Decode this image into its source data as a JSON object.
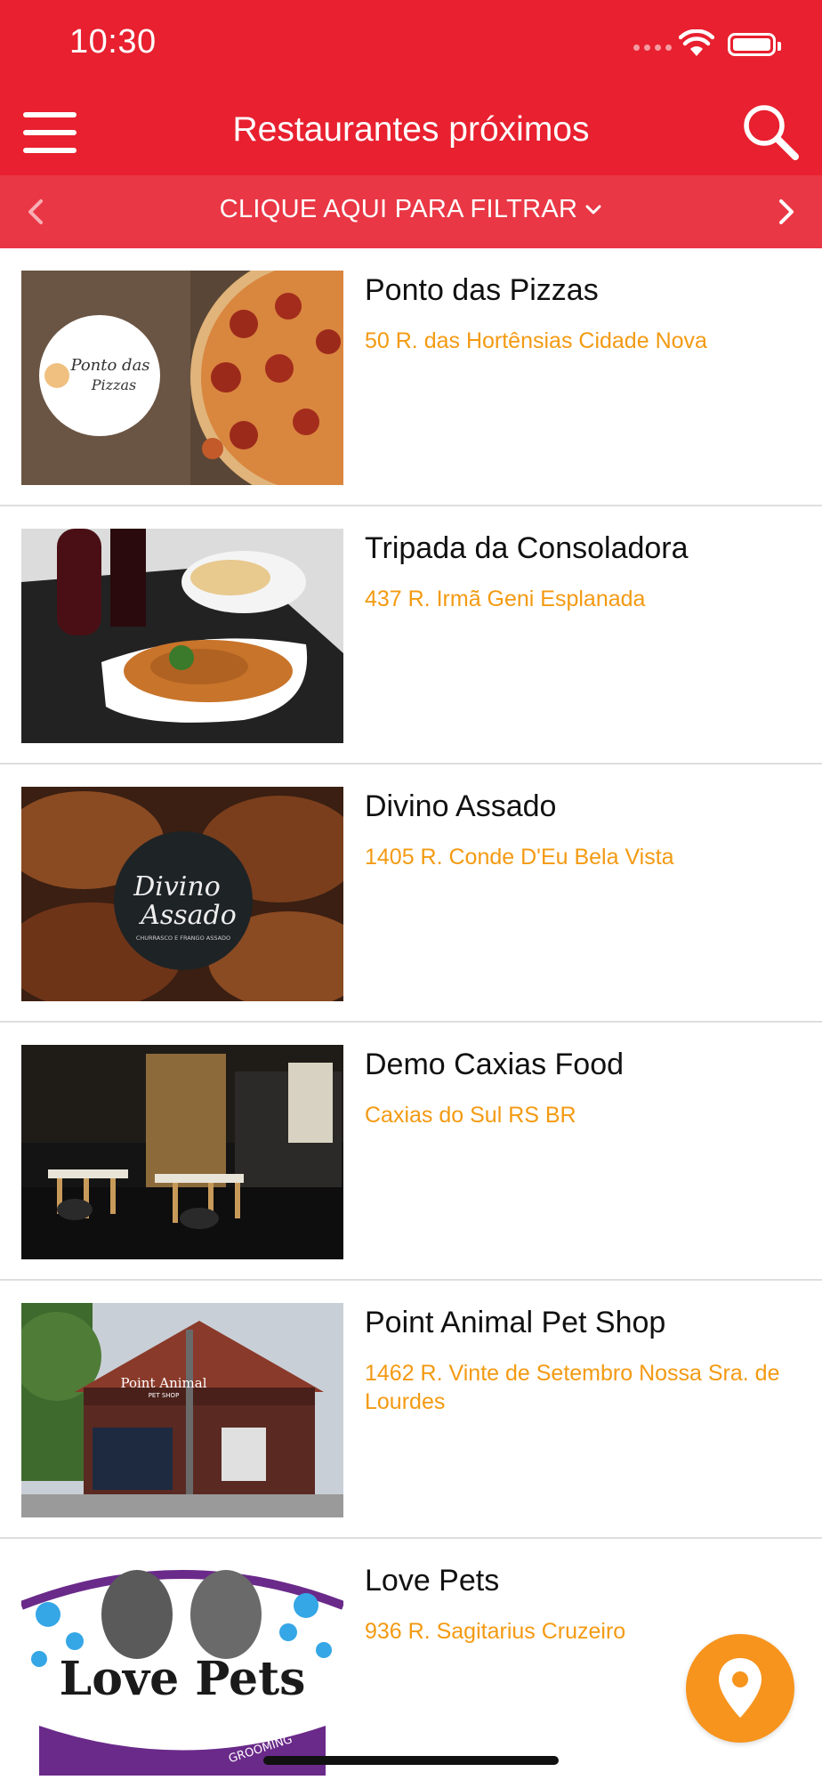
{
  "status_bar": {
    "time": "10:30"
  },
  "header": {
    "title": "Restaurantes próximos",
    "menu_icon": "hamburger-menu-icon",
    "search_icon": "search-icon"
  },
  "filter": {
    "label": "CLIQUE AQUI PARA FILTRAR"
  },
  "restaurants": [
    {
      "name": "Ponto das Pizzas",
      "address": "50 R. das Hortênsias Cidade Nova",
      "logo_text": [
        "Ponto das",
        "Pizzas"
      ]
    },
    {
      "name": "Tripada da Consoladora",
      "address": "437 R. Irmã Geni Esplanada"
    },
    {
      "name": "Divino Assado",
      "address": "1405 R. Conde D'Eu Bela Vista",
      "logo_text": [
        "Divino",
        "Assado",
        "CHURRASCO E FRANGO ASSADO"
      ]
    },
    {
      "name": "Demo Caxias Food",
      "address": "Caxias do Sul RS BR"
    },
    {
      "name": "Point Animal Pet Shop",
      "address": "1462 R. Vinte de Setembro Nossa Sra. de Lourdes",
      "logo_text": [
        "Point Animal",
        "PET SHOP"
      ]
    },
    {
      "name": "Love Pets",
      "address": "936 R. Sagitarius Cruzeiro",
      "logo_text": [
        "Love Pets",
        "GROOMING"
      ]
    }
  ],
  "colors": {
    "header_bg": "#e8202f",
    "filter_bg": "#ea3745",
    "address": "#f39a12",
    "fab": "#f7941d"
  },
  "fab": {
    "icon": "map-pin-icon"
  }
}
